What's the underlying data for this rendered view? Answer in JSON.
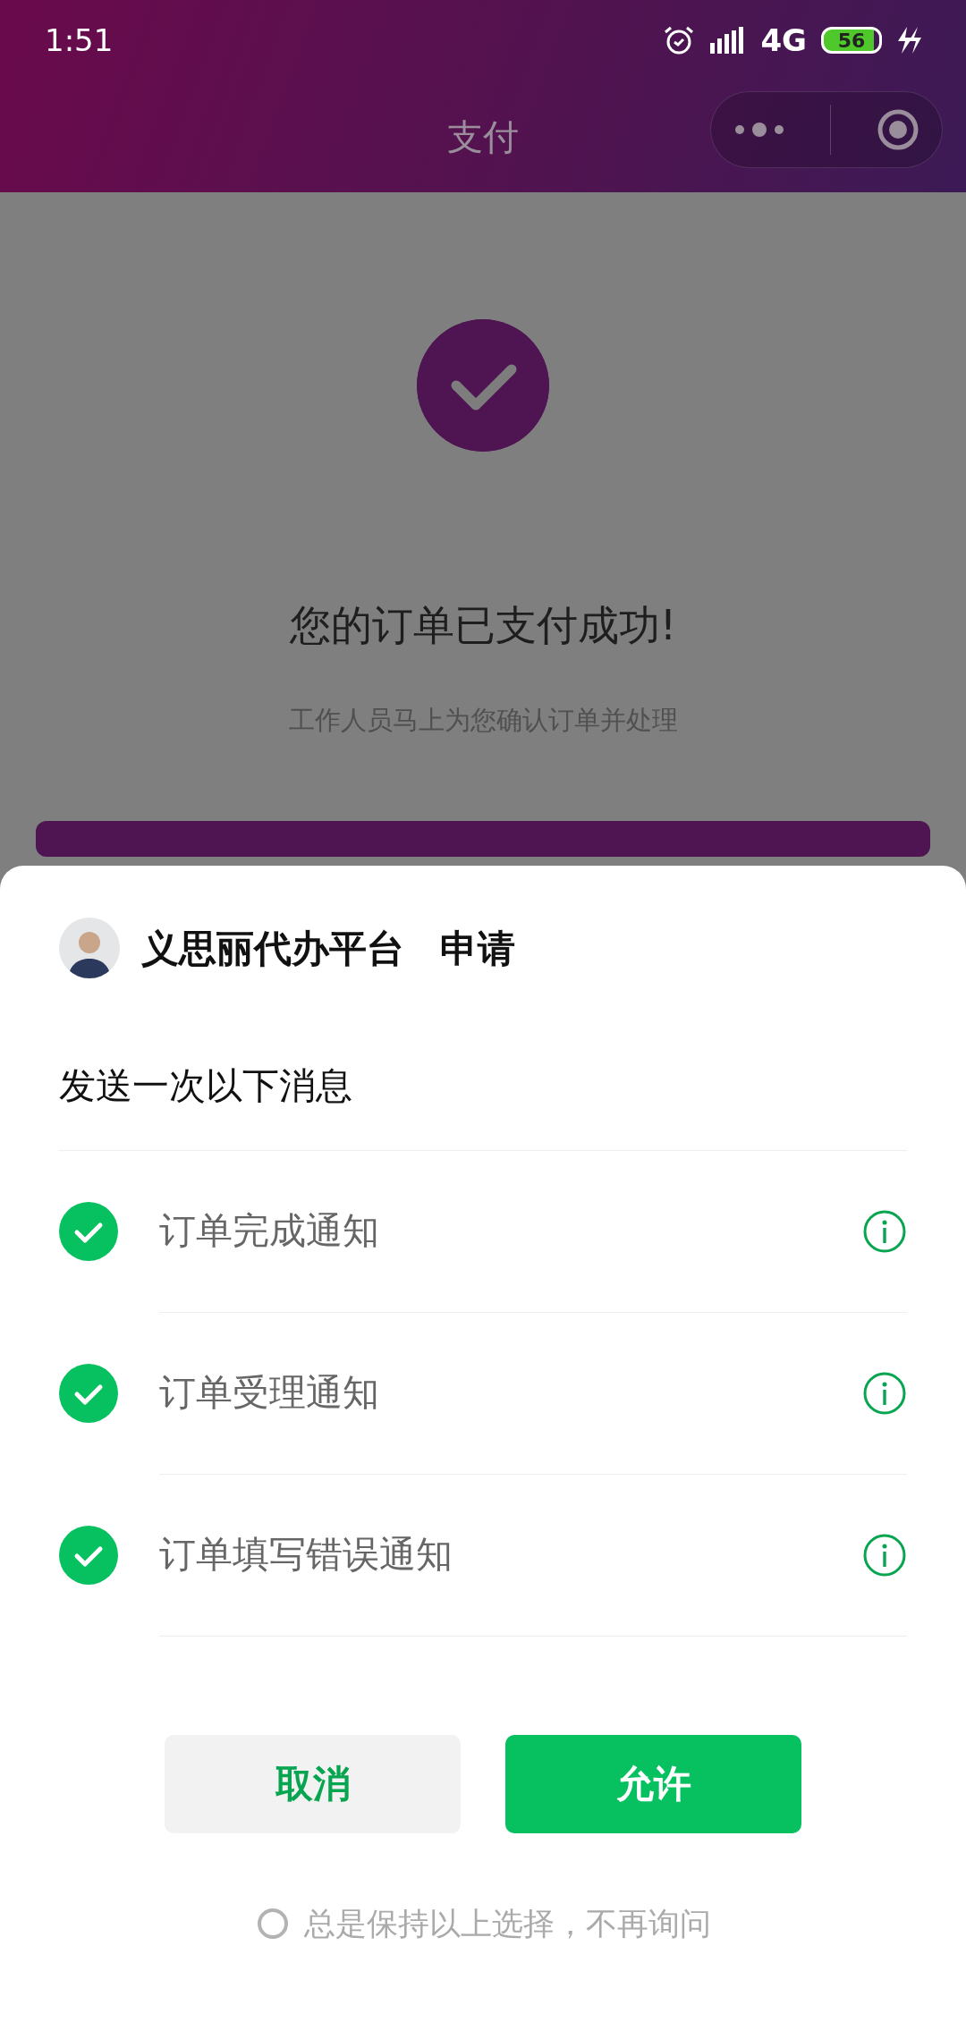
{
  "status_bar": {
    "time": "1:51",
    "network": "4G",
    "battery": "56"
  },
  "header": {
    "title": "支付"
  },
  "page": {
    "title": "您的订单已支付成功!",
    "subtitle": "工作人员马上为您确认订单并处理"
  },
  "sheet": {
    "app_name": "义思丽代办平台",
    "action": "申请",
    "heading": "发送一次以下消息",
    "items": [
      {
        "label": "订单完成通知",
        "checked": true
      },
      {
        "label": "订单受理通知",
        "checked": true
      },
      {
        "label": "订单填写错误通知",
        "checked": true
      }
    ],
    "buttons": [
      {
        "label": "取消",
        "kind": "secondary"
      },
      {
        "label": "允许",
        "kind": "primary"
      }
    ],
    "remember": {
      "label": "总是保持以上选择，不再询问",
      "checked": false
    }
  }
}
